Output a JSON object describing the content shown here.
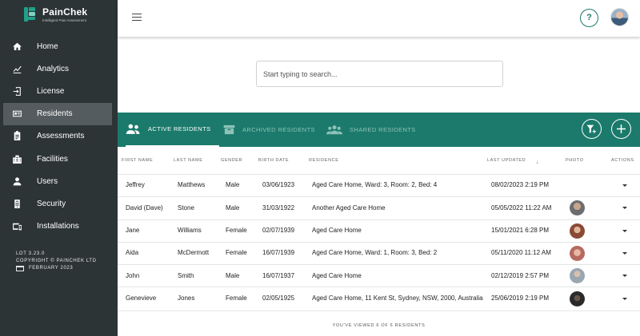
{
  "brand": {
    "name": "PainChek",
    "tagline": "Intelligent Pain Assessment",
    "color": "#1fa18a"
  },
  "sidebar": {
    "items": [
      {
        "label": "Home",
        "icon": "home-icon"
      },
      {
        "label": "Analytics",
        "icon": "analytics-icon"
      },
      {
        "label": "License",
        "icon": "license-icon"
      },
      {
        "label": "Residents",
        "icon": "residents-icon",
        "active": true
      },
      {
        "label": "Assessments",
        "icon": "assessments-icon"
      },
      {
        "label": "Facilities",
        "icon": "facilities-icon"
      },
      {
        "label": "Users",
        "icon": "users-icon"
      },
      {
        "label": "Security",
        "icon": "security-icon"
      },
      {
        "label": "Installations",
        "icon": "installations-icon"
      }
    ],
    "footer": {
      "lot": "LOT 3.23.0",
      "copyright": "COPYRIGHT © PAINCHEK LTD",
      "date": "FEBRUARY 2023"
    }
  },
  "topbar": {
    "help": "?"
  },
  "search": {
    "placeholder": "Start typing to search..."
  },
  "tabs": [
    {
      "label": "ACTIVE RESIDENTS",
      "active": true
    },
    {
      "label": "ARCHIVED RESIDENTS"
    },
    {
      "label": "SHARED RESIDENTS"
    }
  ],
  "table": {
    "headers": {
      "first": "FIRST NAME",
      "last": "LAST NAME",
      "gender": "GENDER",
      "birth": "BIRTH DATE",
      "residence": "RESIDENCE",
      "updated": "LAST UPDATED",
      "photo": "PHOTO",
      "actions": "ACTIONS"
    },
    "rows": [
      {
        "first": "Jeffrey",
        "last": "Matthews",
        "gender": "Male",
        "birth": "03/06/1923",
        "residence": "Aged Care Home, Ward: 3, Room: 2, Bed: 4",
        "updated": "08/02/2023 2:19 PM",
        "photo": "none"
      },
      {
        "first": "David (Dave)",
        "last": "Stone",
        "gender": "Male",
        "birth": "31/03/1922",
        "residence": "Another Aged Care Home",
        "updated": "05/05/2022 11:22 AM",
        "photo": "#6b6e70"
      },
      {
        "first": "Jane",
        "last": "Williams",
        "gender": "Female",
        "birth": "02/07/1939",
        "residence": "Aged Care Home",
        "updated": "15/01/2021 6:28 PM",
        "photo": "#8a4a36"
      },
      {
        "first": "Aida",
        "last": "McDermott",
        "gender": "Female",
        "birth": "16/07/1939",
        "residence": "Aged Care Home, Ward: 1, Room: 3, Bed: 2",
        "updated": "05/11/2020 11:12 AM",
        "photo": "#b56a60"
      },
      {
        "first": "John",
        "last": "Smith",
        "gender": "Male",
        "birth": "16/07/1937",
        "residence": "Aged Care Home",
        "updated": "02/12/2019 2:57 PM",
        "photo": "#9aa6b2"
      },
      {
        "first": "Genevieve",
        "last": "Jones",
        "gender": "Female",
        "birth": "02/05/1925",
        "residence": "Aged Care Home, 11 Kent St, Sydney, NSW, 2000, Australia",
        "updated": "25/06/2019 2:19 PM",
        "photo": "#2a2a2a"
      }
    ],
    "viewed": "YOU'VE VIEWED 6 OF 6 RESIDENTS"
  }
}
